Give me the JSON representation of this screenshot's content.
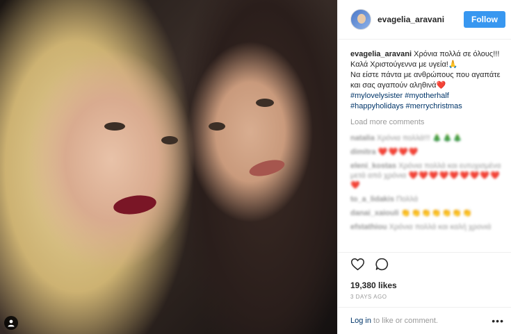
{
  "header": {
    "username": "evagelia_aravani",
    "follow_label": "Follow"
  },
  "caption": {
    "username": "evagelia_aravani",
    "line1": "Χρόνια πολλά σε όλους!!!",
    "line2": "Καλά Χριστούγεννα με υγεία!🙏",
    "line3": "Να είστε πάντα με ανθρώπους που αγαπάτε και σας αγαπούν αληθινά❤️",
    "hashtags": [
      "#mylovelysister",
      "#myotherhalf",
      "#happyholidays",
      "#merrychristmas"
    ]
  },
  "load_more": "Load more comments",
  "blurred_comments": [
    {
      "user": "natalia",
      "text": "Χρόνια πολλά!!!",
      "emoji": "🎄🎄🎄"
    },
    {
      "user": "dimitra",
      "text": "",
      "emoji": "❤️❤️❤️❤️"
    },
    {
      "user": "eleni_kostas",
      "text": "Χρόνια πολλά και ευτυχισμένα μετά από χρόνια",
      "emoji": "❤️❤️❤️❤️❤️❤️❤️❤️❤️❤️"
    },
    {
      "user": "to_a_lidakis",
      "text": "Πολλά",
      "emoji": ""
    },
    {
      "user": "danai_xaiouli",
      "text": "",
      "emoji": "👏👏👏👏👏👏👏"
    },
    {
      "user": "efstathiou",
      "text": "Χρόνια πολλά και καλή χρονιά",
      "emoji": ""
    }
  ],
  "likes": "19,380 likes",
  "time_ago": "3 DAYS AGO",
  "login": {
    "link": "Log in",
    "rest": " to like or comment.",
    "more": "•••"
  },
  "icons": {
    "like": "heart-icon",
    "comment": "comment-icon",
    "user_tag": "user-icon",
    "more": "more-options-icon"
  },
  "colors": {
    "follow_button": "#3897f0",
    "hashtag": "#003569",
    "muted": "#999999"
  }
}
